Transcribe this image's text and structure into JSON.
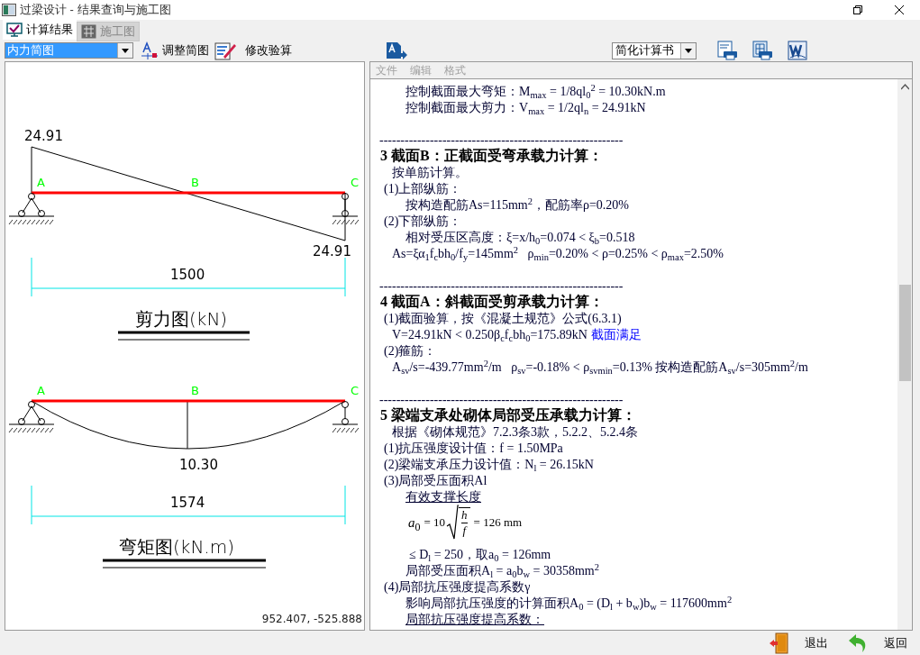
{
  "window": {
    "title": "过梁设计 - 结果查询与施工图"
  },
  "tabs": [
    {
      "label": "计算结果",
      "selected": true
    },
    {
      "label": "施工图",
      "selected": false
    }
  ],
  "toolbar": {
    "view_select": "内力简图",
    "adjust_button": "调整简图",
    "edit_button": "修改验算",
    "report_select": "简化计算书"
  },
  "diagrams": [
    {
      "kind": "shear",
      "start_value": "24.91",
      "end_value": "24.91",
      "points": [
        "A",
        "B",
        "C"
      ],
      "span": "1500",
      "title": "剪力图(kN)"
    },
    {
      "kind": "moment",
      "mid_value": "10.30",
      "points": [
        "A",
        "B",
        "C"
      ],
      "span": "1574",
      "title": "弯矩图(kN.m)"
    }
  ],
  "cursor_coordinates": "952.407, -525.888",
  "menu": [
    {
      "label": "文件",
      "disabled": true
    },
    {
      "label": "编辑",
      "disabled": true
    },
    {
      "label": "格式",
      "disabled": true
    }
  ],
  "document": [
    {
      "kind": "detail",
      "text": "控制截面最大弯矩：M$_{max}$ = 1/8ql$_{0}$$^{2}$ = 10.30kN.m"
    },
    {
      "kind": "detail",
      "text": "控制截面最大剪力：V$_{max}$ = 1/2ql$_{n}$ = 24.91kN"
    },
    {
      "kind": "gap"
    },
    {
      "kind": "rule",
      "text": "----------------------------------------------------------"
    },
    {
      "kind": "heading",
      "text": "3 截面B：正截面受弯承载力计算："
    },
    {
      "kind": "note",
      "text": "按单筋计算。"
    },
    {
      "kind": "item",
      "text": "(1)上部纵筋："
    },
    {
      "kind": "detail",
      "text": "按构造配筋As=115mm$^{2}$，配筋率ρ=0.20%"
    },
    {
      "kind": "item",
      "text": "(2)下部纵筋："
    },
    {
      "kind": "detail",
      "text": "相对受压区高度：ξ=x/h$_{0}$=0.074 < ξ$_{b}$=0.518"
    },
    {
      "kind": "note",
      "text": "As=ξα$_{1}$f$_{c}$bh$_{0}$/f$_{y}$=145mm$^{2}$   ρ$_{min}$=0.20% < ρ=0.25% < ρ$_{max}$=2.50%"
    },
    {
      "kind": "gap"
    },
    {
      "kind": "rule",
      "text": "----------------------------------------------------------"
    },
    {
      "kind": "heading",
      "text": "4 截面A：斜截面受剪承载力计算："
    },
    {
      "kind": "item",
      "text": "(1)截面验算，按《混凝土规范》公式(6.3.1)"
    },
    {
      "kind": "note",
      "text": "V=24.91kN < 0.250β$_{c}$f$_{c}$bh$_{0}$=175.89kN",
      "remark": "截面满足"
    },
    {
      "kind": "item",
      "text": "(2)箍筋："
    },
    {
      "kind": "note",
      "text": "A$_{sv}$/s=-439.77mm$^{2}$/m   ρ$_{sv}$=-0.18% < ρ$_{svmin}$=0.13% 按构造配筋A$_{sv}$/s=305mm$^{2}$/m"
    },
    {
      "kind": "gap"
    },
    {
      "kind": "rule",
      "text": "----------------------------------------------------------"
    },
    {
      "kind": "heading",
      "text": "5 梁端支承处砌体局部受压承载力计算："
    },
    {
      "kind": "note",
      "text": "根据《砌体规范》7.2.3条3款，5.2.2、5.2.4条"
    },
    {
      "kind": "item",
      "text": "(1)抗压强度设计值：f = 1.50MPa"
    },
    {
      "kind": "item",
      "text": "(2)梁端支承压力设计值：N$_{l}$ = 26.15kN"
    },
    {
      "kind": "item",
      "text": "(3)局部受压面积Al"
    },
    {
      "kind": "underlined",
      "text": "有效支撑长度"
    },
    {
      "kind": "formula",
      "symbol": "a",
      "index": "0",
      "coefficient": "= 10",
      "numerator": "h",
      "denominator": "f",
      "result": "= 126 mm"
    },
    {
      "kind": "deep",
      "text": "≤ D$_{l}$ = 250，取a$_{0}$ = 126mm"
    },
    {
      "kind": "detail",
      "text": "局部受压面积A$_{l}$ = a$_{0}$b$_{w}$ = 30358mm$^{2}$"
    },
    {
      "kind": "item",
      "text": "(4)局部抗压强度提高系数γ"
    },
    {
      "kind": "detail",
      "text": "影响局部抗压强度的计算面积A$_{0}$ = (D$_{l}$ + b$_{w}$)b$_{w}$ = 117600mm$^{2}$"
    },
    {
      "kind": "underlined",
      "text": "局部抗压强度提高系数："
    }
  ],
  "bottom_buttons": [
    {
      "kind": "exit",
      "label": "退出"
    },
    {
      "kind": "back",
      "label": "返回"
    }
  ]
}
